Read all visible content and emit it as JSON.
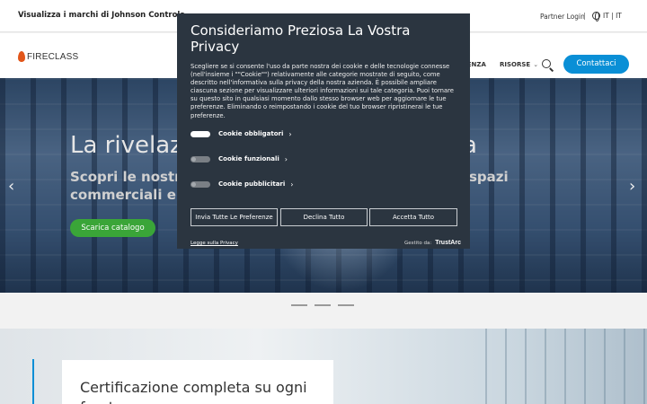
{
  "topbar": {
    "brands_label": "Visualizza i marchi di Johnson Controls",
    "partner_login": "Partner Login",
    "separator": "|",
    "language": "IT | IT"
  },
  "header": {
    "logo_text": "FIRECLASS",
    "nav": [
      {
        "label": "TENZA"
      },
      {
        "label": "RISORSE"
      }
    ],
    "contact_label": "Contattaci"
  },
  "hero": {
    "title": "La rivelaz",
    "title_right": "a",
    "subtitle_line1": "Scopri le nostre s",
    "subtitle_line1_right": "spazi",
    "subtitle_line2": "commerciali e re",
    "cta_label": "Scarica catalogo",
    "prev_arrow": "‹",
    "next_arrow": "›"
  },
  "lower": {
    "card_title": "Certificazione completa su ogni fronte"
  },
  "privacy_modal": {
    "title": "Consideriamo Preziosa La Vostra Privacy",
    "body": "Scegliere se si consente l'uso da parte nostra dei cookie e delle tecnologie connesse (nell'insieme i \"\"Cookie\"\") relativamente alle categorie mostrate di seguito, come descritto nell'informativa sulla privacy della nostra azienda. È possibile ampliare ciascuna sezione per visualizzare ulteriori informazioni sui tale categoria. Puoi tornare su questo sito in qualsiasi momento dallo stesso browser web per aggiornare le tue preferenze. Eliminando o reimpostando i cookie del tuo browser ripristinerai le tue preferenze.",
    "categories": [
      {
        "label": "Cookie obbligatori",
        "enabled": true
      },
      {
        "label": "Cookie funzionali",
        "enabled": false
      },
      {
        "label": "Cookie pubblicitari",
        "enabled": false
      }
    ],
    "buttons": {
      "submit": "Invia Tutte Le Preferenze",
      "decline": "Declina Tutto",
      "accept": "Accetta Tutto"
    },
    "legal_link": "Legge sulla Privacy",
    "managed_by": "Gestito da:",
    "provider": "TrustArc"
  },
  "colors": {
    "accent_blue": "#0a8fd6",
    "cta_green": "#3aa538",
    "modal_bg": "#2b3540",
    "logo_flame": "#e2561a"
  }
}
